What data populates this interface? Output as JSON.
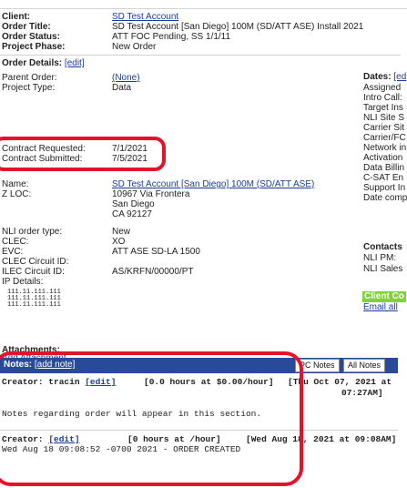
{
  "header": {
    "client_label": "Client:",
    "client_value": "SD Test Account",
    "order_title_label": "Order Title:",
    "order_title_value": "SD Test Account [San Diego] 100M (SD/ATT ASE) Install 2021",
    "order_status_label": "Order Status:",
    "order_status_value": "ATT FOC Pending, SS 1/1/11",
    "project_phase_label": "Project Phase:",
    "project_phase_value": "New Order"
  },
  "order_details": {
    "title": "Order Details:",
    "edit_link": "[edit]",
    "fields": [
      {
        "label": "Parent Order:",
        "value": "(None)",
        "link": true
      },
      {
        "label": "Project Type:",
        "value": "Data",
        "link": false
      },
      {
        "label": "Contract Requested:",
        "value": "7/1/2021",
        "link": false
      },
      {
        "label": "Contract Submitted:",
        "value": "7/5/2021",
        "link": false
      },
      {
        "label": "Name:",
        "value": "SD Test Account [San Diego] 100M (SD/ATT ASE)",
        "link": true
      }
    ],
    "zloc_label": "Z LOC:",
    "zloc_lines": [
      "10967 Via Frontera",
      "San Diego",
      "CA 92127"
    ],
    "more_fields": [
      {
        "label": "NLI order type:",
        "value": "New"
      },
      {
        "label": "CLEC:",
        "value": "XO"
      },
      {
        "label": "EVC:",
        "value": "ATT ASE SD-LA 1500"
      },
      {
        "label": "CLEC Circuit ID:",
        "value": ""
      },
      {
        "label": "ILEC Circuit ID:",
        "value": "AS/KRFN/00000/PT"
      },
      {
        "label": "IP Details:",
        "value": ""
      }
    ],
    "ip_lines": [
      "111.11.111.111",
      "111.11.111.111",
      "111.11.111.111"
    ]
  },
  "dates": {
    "title": "Dates:",
    "edit_link": "[ed",
    "items": [
      "Assigned",
      "Intro Call:",
      "Target Ins",
      "NLI Site S",
      "Carrier Sit",
      "Carrier/FC",
      "Network in",
      "Activation",
      "Data Billin",
      "C-SAT En",
      "Support In",
      "Date comp"
    ]
  },
  "contacts": {
    "title": "Contacts",
    "items": [
      "NLI PM:",
      "NLI Sales"
    ],
    "client_contacts": "Client Co",
    "email_all": "Email all"
  },
  "attachments": {
    "title": "Attachments:",
    "add_link": "Add Attachment"
  },
  "notes": {
    "title": "Notes:",
    "add_note": "[add note]",
    "pc_notes": "PC Notes",
    "all_notes": "All Notes",
    "entries": [
      {
        "creator": "Creator: tracin",
        "edit": "[edit]",
        "time": "[0.0 hours at $0.00/hour]",
        "date_line1": "[Thu Oct 07, 2021 at",
        "date_line2": "07:27AM]",
        "body": "Notes regarding order will appear in this section."
      },
      {
        "creator": "Creator:",
        "edit": "[edit]",
        "time": "[0 hours at /hour]",
        "date_line1": "[Wed Aug 18, 2021 at 09:08AM]",
        "body": "Wed Aug 18 09:08:52 -0700 2021 - ORDER CREATED"
      }
    ]
  },
  "colors": {
    "accent": "#294a99",
    "highlight": "#e6112a",
    "client_badge": "#7ad43a",
    "link": "#1a3c9c"
  }
}
